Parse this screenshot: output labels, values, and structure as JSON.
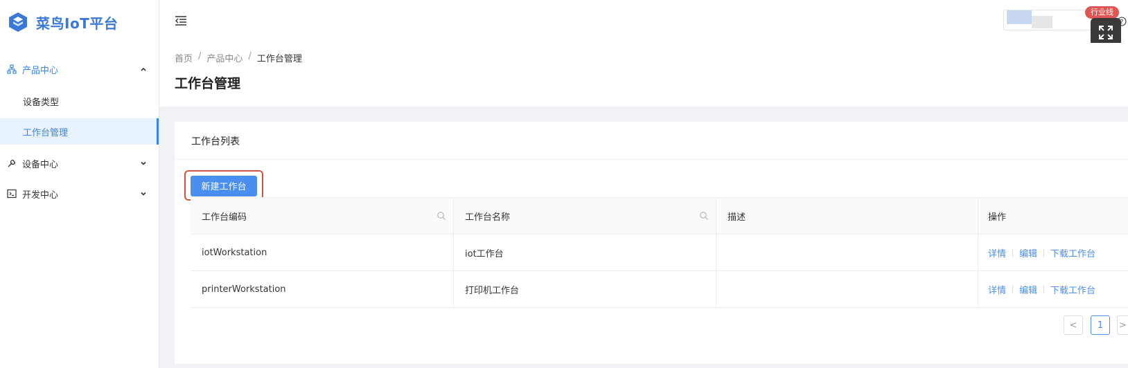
{
  "app": {
    "logo_text": "菜鸟IoT平台"
  },
  "sidebar": {
    "items": [
      {
        "label": "产品中心",
        "icon": "sitemap-icon",
        "expanded": true
      },
      {
        "label": "设备类型"
      },
      {
        "label": "工作台管理",
        "active": true
      },
      {
        "label": "设备中心",
        "icon": "wrench-icon",
        "expanded": false
      },
      {
        "label": "开发中心",
        "icon": "terminal-icon",
        "expanded": false
      }
    ]
  },
  "topbar": {
    "industry_badge": "行业线"
  },
  "breadcrumb": {
    "items": [
      "首页",
      "产品中心",
      "工作台管理"
    ],
    "separator": "/"
  },
  "page": {
    "title": "工作台管理"
  },
  "card": {
    "title": "工作台列表",
    "new_button": "新建工作台"
  },
  "table": {
    "columns": [
      "工作台编码",
      "工作台名称",
      "描述",
      "操作"
    ],
    "rows": [
      {
        "code": "iotWorkstation",
        "name": "iot工作台",
        "desc": "",
        "actions": [
          "详情",
          "编辑",
          "下载工作台"
        ]
      },
      {
        "code": "printerWorkstation",
        "name": "打印机工作台",
        "desc": "",
        "actions": [
          "详情",
          "编辑",
          "下载工作台"
        ]
      }
    ]
  },
  "pagination": {
    "prev": "<",
    "current_page": "1",
    "next": ">"
  },
  "colors": {
    "accent": "#3a84e8",
    "button": "#4a8ef0",
    "highlight": "#d0533f",
    "badge": "#e25555"
  }
}
